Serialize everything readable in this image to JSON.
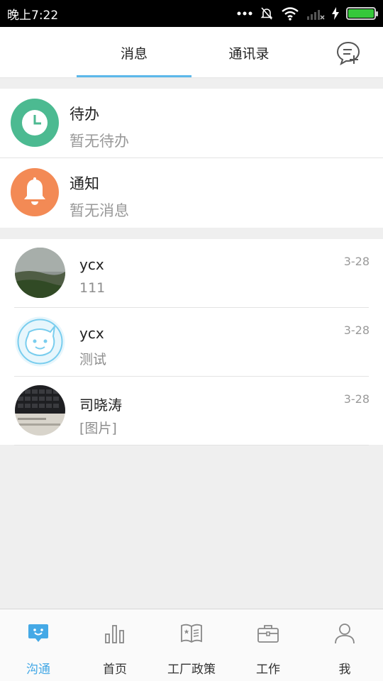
{
  "status_bar": {
    "time": "晚上7:22"
  },
  "tabs": {
    "messages": "消息",
    "contacts": "通讯录"
  },
  "system_items": [
    {
      "title": "待办",
      "subtitle": "暂无待办",
      "icon": "clock-icon",
      "color": "#4cba91"
    },
    {
      "title": "通知",
      "subtitle": "暂无消息",
      "icon": "bell-icon",
      "color": "#f38a55"
    }
  ],
  "chats": [
    {
      "name": "ycx",
      "message": "111",
      "date": "3-28",
      "avatar": "landscape-photo"
    },
    {
      "name": "ycx",
      "message": "测试",
      "date": "3-28",
      "avatar": "smiley-avatar"
    },
    {
      "name": "司晓涛",
      "message": "[图片]",
      "date": "3-28",
      "avatar": "keyboard-photo"
    }
  ],
  "bottom_nav": [
    {
      "label": "沟通",
      "icon": "chat-icon",
      "active": true
    },
    {
      "label": "首页",
      "icon": "bar-chart-icon",
      "active": false
    },
    {
      "label": "工厂政策",
      "icon": "book-icon",
      "active": false
    },
    {
      "label": "工作",
      "icon": "briefcase-icon",
      "active": false
    },
    {
      "label": "我",
      "icon": "person-icon",
      "active": false
    }
  ],
  "colors": {
    "accent": "#45a9e6",
    "tab_underline": "#5cb8ea"
  }
}
